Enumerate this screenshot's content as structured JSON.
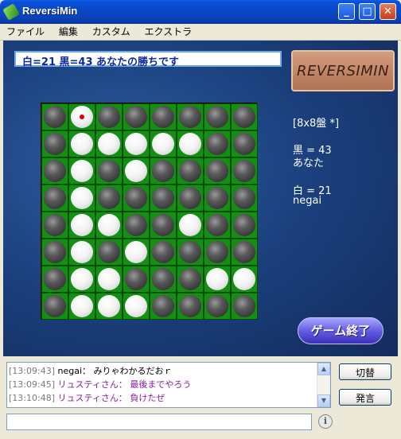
{
  "window": {
    "title": "ReversiMin",
    "minimize_glyph": "_",
    "maximize_glyph": "□",
    "close_glyph": "✕"
  },
  "menu": [
    "ファイル",
    "編集",
    "カスタム",
    "エクストラ"
  ],
  "status": "白=21 黒=43 あなたの勝ちです",
  "logo": "REVERSIMIN",
  "info": {
    "board_size": "[8x8盤 *]",
    "black_score": "黒 = 43",
    "black_player": "あなた",
    "white_score": "白 = 21",
    "white_player": "negai"
  },
  "board": [
    "BWBBBBBB",
    "BWWWWWBB",
    "BWBWBBBB",
    "BWBBBBBB",
    "BWWBBWBB",
    "BWBWBBBB",
    "BWWBBBWW",
    "BWWWBBBB"
  ],
  "last_move": {
    "row": 0,
    "col": 1
  },
  "end_button": "ゲーム終了",
  "chat": [
    {
      "time": "[13:09:43]",
      "msg": "negai： みりゃわかるだおｒ"
    },
    {
      "time": "[13:09:45]",
      "msg": "リュスティさん： 最後までやろう"
    },
    {
      "time": "[13:10:48]",
      "msg": "リュスティさん： 負けたぜ"
    }
  ],
  "buttons": {
    "switch": "切替",
    "speak": "発言"
  },
  "input": {
    "value": "",
    "info_glyph": "i"
  },
  "icons": {
    "app": "reversimin-app-icon",
    "info": "info-icon",
    "scroll_up": "scroll-up-icon",
    "scroll_down": "scroll-down-icon"
  }
}
